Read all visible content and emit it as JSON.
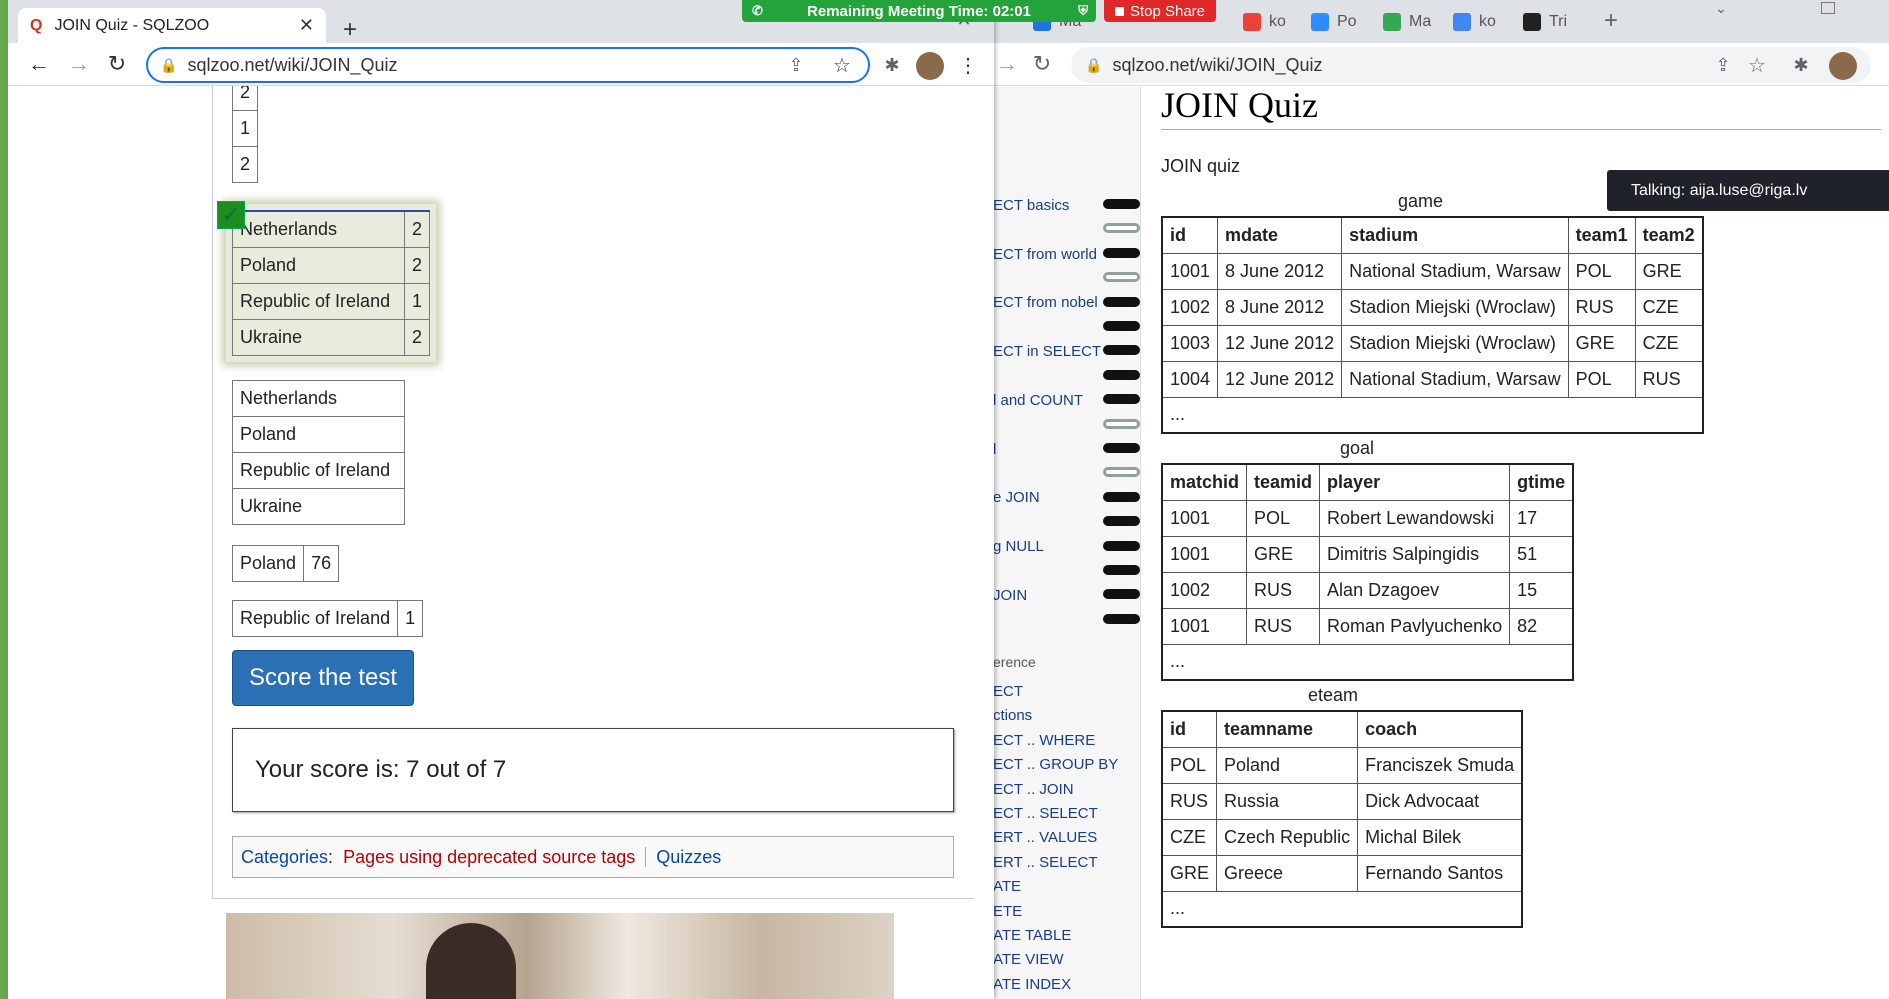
{
  "desktop_bg": "#6aa84f",
  "meeting_bar": {
    "text": "Remaining Meeting Time: 02:01",
    "stop_share": "Stop Share"
  },
  "talking": {
    "text": "Talking: aija.luse@riga.lv"
  },
  "left_browser": {
    "tab_title": "JOIN Quiz - SQLZOO",
    "url": "sqlzoo.net/wiki/JOIN_Quiz",
    "partial_rows": [
      "2",
      "1",
      "2"
    ],
    "answer_correct": [
      {
        "team": "Netherlands",
        "n": "2"
      },
      {
        "team": "Poland",
        "n": "2"
      },
      {
        "team": "Republic of Ireland",
        "n": "1"
      },
      {
        "team": "Ukraine",
        "n": "2"
      }
    ],
    "check_mark": "✓",
    "answer_names": [
      "Netherlands",
      "Poland",
      "Republic of Ireland",
      "Ukraine"
    ],
    "answer_poland": {
      "team": "Poland",
      "n": "76"
    },
    "answer_ireland": {
      "team": "Republic of Ireland",
      "n": "1"
    },
    "score_button": "Score the test",
    "score_text": "Your score is: 7 out of 7",
    "categories_label": "Categories",
    "categories_colon": ":",
    "category_1": "Pages using deprecated source tags",
    "category_2": "Quizzes"
  },
  "right_browser": {
    "tabs": [
      {
        "label": "Ma",
        "icon_color": "#1a73e8"
      },
      {
        "label": "ko",
        "icon_color": "#ea4335"
      },
      {
        "label": "Po",
        "icon_color": "#2d8cff"
      },
      {
        "label": "Ma",
        "icon_color": "#34a853"
      },
      {
        "label": "ko",
        "icon_color": "#4285f4"
      },
      {
        "label": "Tri",
        "icon_color": "#222222"
      }
    ],
    "url": "sqlzoo.net/wiki/JOIN_Quiz",
    "page_title": "JOIN Quiz",
    "intro": "JOIN quiz",
    "nav": [
      "ECT basics",
      "ECT from world",
      "ECT from nobel",
      "ECT in SELECT",
      "l and COUNT",
      "l",
      "e JOIN",
      "g NULL",
      "JOIN"
    ],
    "nav_status": [
      "done",
      "hollow",
      "done",
      "hollow",
      "done",
      "done",
      "done",
      "done",
      "done",
      "hollow",
      "done",
      "hollow",
      "done",
      "done",
      "done",
      "done",
      "done",
      "done"
    ],
    "reference_heading": "erence",
    "reference": [
      "ECT",
      "ctions",
      "ECT .. WHERE",
      "ECT .. GROUP BY",
      "ECT .. JOIN",
      "ECT .. SELECT",
      "ERT .. VALUES",
      "ERT .. SELECT",
      "ATE",
      "ETE",
      "ATE TABLE",
      "ATE VIEW",
      "ATE INDEX"
    ],
    "game": {
      "caption": "game",
      "headers": [
        "id",
        "mdate",
        "stadium",
        "team1",
        "team2"
      ],
      "rows": [
        [
          "1001",
          "8 June 2012",
          "National Stadium, Warsaw",
          "POL",
          "GRE"
        ],
        [
          "1002",
          "8 June 2012",
          "Stadion Miejski (Wroclaw)",
          "RUS",
          "CZE"
        ],
        [
          "1003",
          "12 June 2012",
          "Stadion Miejski (Wroclaw)",
          "GRE",
          "CZE"
        ],
        [
          "1004",
          "12 June 2012",
          "National Stadium, Warsaw",
          "POL",
          "RUS"
        ]
      ],
      "ellipsis": "..."
    },
    "goal": {
      "caption": "goal",
      "headers": [
        "matchid",
        "teamid",
        "player",
        "gtime"
      ],
      "rows": [
        [
          "1001",
          "POL",
          "Robert Lewandowski",
          "17"
        ],
        [
          "1001",
          "GRE",
          "Dimitris Salpingidis",
          "51"
        ],
        [
          "1002",
          "RUS",
          "Alan Dzagoev",
          "15"
        ],
        [
          "1001",
          "RUS",
          "Roman Pavlyuchenko",
          "82"
        ]
      ],
      "ellipsis": "..."
    },
    "eteam": {
      "caption": "eteam",
      "headers": [
        "id",
        "teamname",
        "coach"
      ],
      "rows": [
        [
          "POL",
          "Poland",
          "Franciszek Smuda"
        ],
        [
          "RUS",
          "Russia",
          "Dick Advocaat"
        ],
        [
          "CZE",
          "Czech Republic",
          "Michal Bilek"
        ],
        [
          "GRE",
          "Greece",
          "Fernando Santos"
        ]
      ],
      "ellipsis": "..."
    }
  }
}
